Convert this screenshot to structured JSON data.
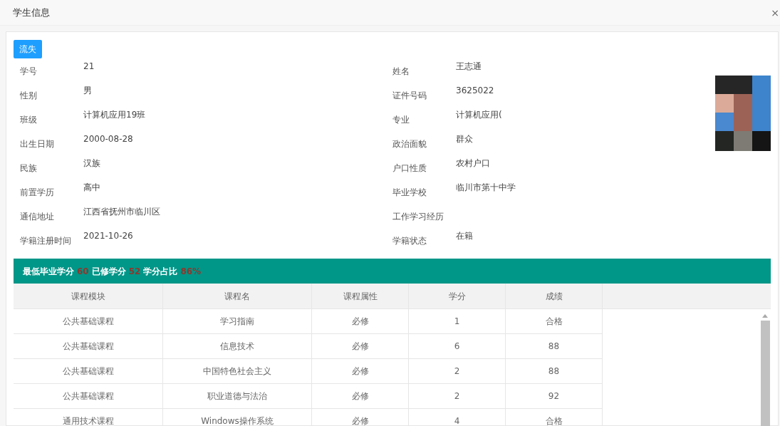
{
  "window": {
    "title": "学生信息",
    "close": "×"
  },
  "action_button": "流失",
  "fields_left": [
    {
      "label": "学号",
      "value": "21"
    },
    {
      "label": "性别",
      "value": "男"
    },
    {
      "label": "班级",
      "value": "计算机应用19班"
    },
    {
      "label": "出生日期",
      "value": "2000-08-28"
    },
    {
      "label": "民族",
      "value": "汉族"
    },
    {
      "label": "前置学历",
      "value": "高中"
    },
    {
      "label": "通信地址",
      "value": "江西省抚州市临川区"
    },
    {
      "label": "学籍注册时间",
      "value": "2021-10-26"
    }
  ],
  "fields_right": [
    {
      "label": "姓名",
      "value": "王志通"
    },
    {
      "label": "证件号码",
      "value": "3625022"
    },
    {
      "label": "专业",
      "value": "计算机应用("
    },
    {
      "label": "政治面貌",
      "value": "群众"
    },
    {
      "label": "户口性质",
      "value": "农村户口"
    },
    {
      "label": "毕业学校",
      "value": "临川市第十中学"
    },
    {
      "label": "工作学习经历"
    },
    {
      "label": "学籍状态",
      "value": "在籍"
    }
  ],
  "summary": [
    {
      "label": "最低毕业学分",
      "value": "60"
    },
    {
      "label": "已修学分",
      "value": "52"
    },
    {
      "label": "学分占比",
      "value": "86%"
    }
  ],
  "table": {
    "columns": [
      "课程模块",
      "课程名",
      "课程属性",
      "学分",
      "成绩"
    ],
    "rows": [
      [
        "公共基础课程",
        "学习指南",
        "必修",
        "1",
        "合格"
      ],
      [
        "公共基础课程",
        "信息技术",
        "必修",
        "6",
        "88"
      ],
      [
        "公共基础课程",
        "中国特色社会主义",
        "必修",
        "2",
        "88"
      ],
      [
        "公共基础课程",
        "职业道德与法治",
        "必修",
        "2",
        "92"
      ],
      [
        "通用技术课程",
        "Windows操作系统",
        "必修",
        "4",
        "合格"
      ]
    ]
  }
}
